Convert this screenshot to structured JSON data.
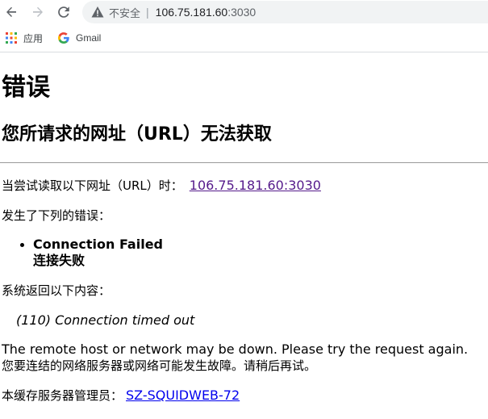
{
  "browser": {
    "back_icon": "arrow-left",
    "forward_icon": "arrow-right",
    "reload_icon": "reload",
    "security_label": "不安全",
    "url_host": "106.75.181.60",
    "url_port": ":3030",
    "bookmarks": [
      {
        "label": "应用",
        "icon": "apps-grid"
      },
      {
        "label": "Gmail",
        "icon": "google-g"
      }
    ]
  },
  "page": {
    "title": "错误",
    "subtitle": "您所请求的网址（URL）无法获取",
    "try_text": "当尝试读取以下网址（URL）时：",
    "try_link": "106.75.181.60:3030",
    "error_intro": "发生了下列的错误：",
    "error_items": [
      {
        "line1": "Connection Failed",
        "line2": "连接失败"
      }
    ],
    "system_text": "系统返回以下内容：",
    "system_message": "(110) Connection timed out",
    "remote_en": "The remote host or network may be down. Please try the request again.",
    "remote_zh": "您要连结的网络服务器或网络可能发生故障。请稍后再试。",
    "admin_text": "本缓存服务器管理员：",
    "admin_link": "SZ-SQUIDWEB-72"
  },
  "colors": {
    "visited_link": "#551a8b",
    "link": "#0000ee",
    "omnibox_bg": "#f1f3f4"
  }
}
